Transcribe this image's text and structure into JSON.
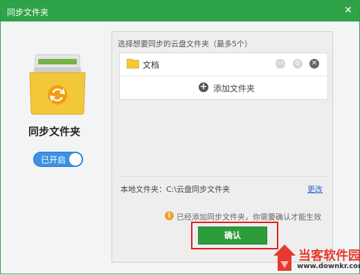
{
  "window": {
    "title": "同步文件夹",
    "close_glyph": "✕"
  },
  "left": {
    "folder_name": "同步文件夹",
    "toggle_label": "已开启",
    "toggle_on": true,
    "folder_color": "#f2c83a",
    "sync_color": "#f39c12"
  },
  "panel": {
    "heading": "选择想要同步的云盘文件夹（最多5个）",
    "folders": [
      {
        "name": "文档"
      }
    ],
    "add_label": "添加文件夹",
    "local_label": "本地文件夹：C:\\云盘同步文件夹",
    "change_link": "更改",
    "notice": "已经添加同步文件夹，你需要确认才能生效",
    "confirm_label": "确认"
  },
  "watermark": {
    "title": "当客软件园",
    "url": "www.downkr.com"
  },
  "colors": {
    "titlebar": "#2fa349",
    "accent_blue": "#3d91e2",
    "confirm_green": "#2d9c3d",
    "highlight_red": "#e21b1b"
  }
}
